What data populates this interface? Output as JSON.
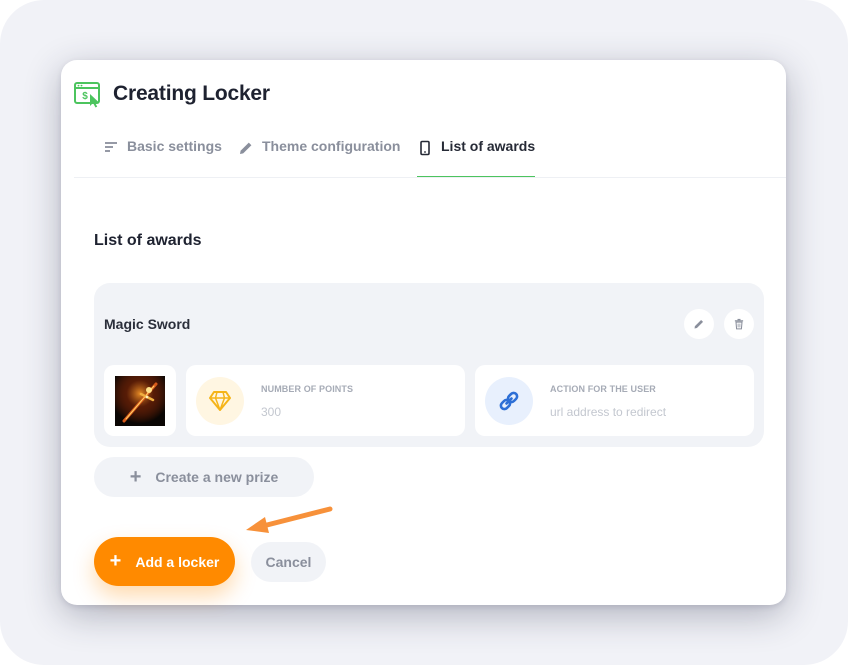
{
  "window": {
    "title": "Creating Locker",
    "icon": "browser-dollar-icon",
    "accent": "#4cc45e"
  },
  "tabs": [
    {
      "label": "Basic settings",
      "icon": "lines-icon",
      "active": false
    },
    {
      "label": "Theme configuration",
      "icon": "pencil-icon",
      "active": false
    },
    {
      "label": "List of awards",
      "icon": "phone-icon",
      "active": true
    }
  ],
  "main": {
    "section_title": "List of awards",
    "prizes": [
      {
        "name": "Magic Sword",
        "image": "magic-sword-image",
        "points": {
          "label": "NUMBER OF POINTS",
          "placeholder": "300",
          "icon": "diamond-icon"
        },
        "action": {
          "label": "ACTION FOR THE USER",
          "placeholder": "url address to redirect",
          "icon": "link-icon"
        }
      }
    ],
    "create_prize_label": "Create a new prize"
  },
  "footer": {
    "add_label": "Add a locker",
    "cancel_label": "Cancel",
    "add_color": "#ff8a00"
  }
}
